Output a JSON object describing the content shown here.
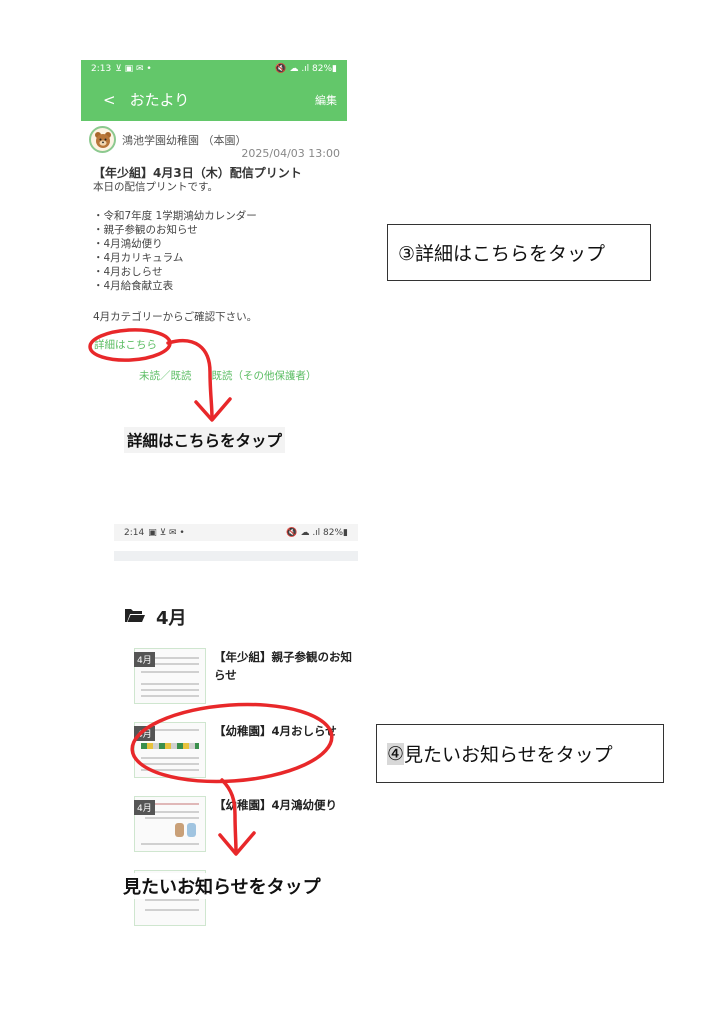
{
  "screen1": {
    "status": {
      "time": "2:13",
      "icons": "⊻ ▣ ✉ •",
      "right": "🔇 ☁ .ıl 82%▮"
    },
    "appbar": {
      "back": "<",
      "title": "おたより",
      "edit": "編集"
    },
    "sender": "鴻池学園幼稚園 （本園）",
    "date": "2025/04/03 13:00",
    "message_title": "【年少組】4月3日（木）配信プリント",
    "message_intro": "本日の配信プリントです。",
    "list": [
      "・令和7年度 1学期鴻幼カレンダー",
      "・親子参観のお知らせ",
      "・4月鴻幼便り",
      "・4月カリキュラム",
      "・4月おしらせ",
      "・4月給食献立表"
    ],
    "footer": "4月カテゴリーからご確認下さい。",
    "detail_link": "詳細はこちら",
    "unread": "未読／既読",
    "read_other": "既読（その他保護者）"
  },
  "screen2": {
    "status": {
      "time": "2:14",
      "icons": "▣ ⊻ ✉ •",
      "right": "🔇 ☁ .ıl 82%▮"
    },
    "folder": "4月",
    "items": [
      {
        "badge": "4月",
        "title": "【年少組】親子参観のお知らせ"
      },
      {
        "badge": "4月",
        "title": "【幼稚園】4月おしらせ"
      },
      {
        "badge": "4月",
        "title": "【幼稚園】4月鴻幼便り"
      }
    ]
  },
  "annotations": {
    "label1": "詳細はこちらをタップ",
    "box1": "③詳細はこちらをタップ",
    "label2": "見たいお知らせをタップ",
    "box2_num": "④",
    "box2_text": "見たいお知らせをタップ"
  },
  "colors": {
    "accent": "#63c76a",
    "link": "#5bbd63",
    "annotation": "#e8282a"
  },
  "icons": [
    "back-chevron-icon",
    "bear-avatar-icon",
    "folder-open-icon"
  ]
}
